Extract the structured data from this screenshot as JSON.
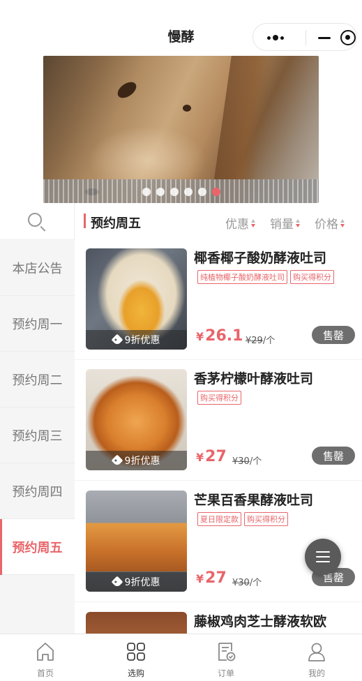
{
  "header": {
    "title": "慢酵"
  },
  "banner": {
    "slide_count": 6,
    "active_index": 5
  },
  "sidebar": {
    "search_icon": "search-icon",
    "categories": [
      {
        "label": "本店公告",
        "active": false
      },
      {
        "label": "预约周一",
        "active": false
      },
      {
        "label": "预约周二",
        "active": false
      },
      {
        "label": "预约周三",
        "active": false
      },
      {
        "label": "预约周四",
        "active": false
      },
      {
        "label": "预约周五",
        "active": true
      }
    ]
  },
  "content": {
    "section_title": "预约周五",
    "sort_options": [
      "优惠",
      "销量",
      "价格"
    ]
  },
  "products": [
    {
      "name": "椰香椰子酸奶酵液吐司",
      "badges": [
        "纯植物椰子酸奶酵液吐司",
        "购买得积分"
      ],
      "discount": "9折优惠",
      "currency": "¥",
      "price": "26.1",
      "original_price": "¥29",
      "unit": "/个",
      "status": "售罄"
    },
    {
      "name": "香茅柠檬叶酵液吐司",
      "badges": [
        "购买得积分"
      ],
      "discount": "9折优惠",
      "currency": "¥",
      "price": "27",
      "original_price": "¥30",
      "unit": "/个",
      "status": "售罄"
    },
    {
      "name": "芒果百香果酵液吐司",
      "badges": [
        "夏日限定款",
        "购买得积分"
      ],
      "discount": "9折优惠",
      "currency": "¥",
      "price": "27",
      "original_price": "¥30",
      "unit": "/个",
      "status": "售罄"
    },
    {
      "name": "藤椒鸡肉芝士酵液软欧"
    }
  ],
  "tabbar": [
    {
      "label": "首页",
      "icon": "home-icon",
      "active": false
    },
    {
      "label": "选购",
      "icon": "grid-icon",
      "active": true
    },
    {
      "label": "订单",
      "icon": "order-icon",
      "active": false
    },
    {
      "label": "我的",
      "icon": "user-icon",
      "active": false
    }
  ],
  "colors": {
    "accent": "#e8656a",
    "sold_out": "#6e6e6e"
  }
}
